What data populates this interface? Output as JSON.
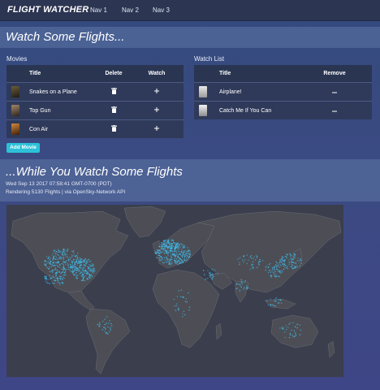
{
  "nav": {
    "brand": "FLIGHT WATCHER",
    "links": [
      "Nav 1",
      "Nav 2",
      "Nav 3"
    ]
  },
  "section1": {
    "title": "Watch Some Flights..."
  },
  "movies": {
    "label": "Movies",
    "columns": {
      "title": "Title",
      "delete": "Delete",
      "watch": "Watch"
    },
    "rows": [
      {
        "title": "Snakes on a Plane",
        "poster_color": "#3b3522"
      },
      {
        "title": "Top Gun",
        "poster_color": "#5a4c3e"
      },
      {
        "title": "Con Air",
        "poster_color": "#8a5a2a"
      }
    ],
    "delete_icon": "trash-icon",
    "watch_icon": "plus-icon",
    "add_button": "Add Movie"
  },
  "watchlist": {
    "label": "Watch List",
    "columns": {
      "title": "Title",
      "remove": "Remove"
    },
    "rows": [
      {
        "title": "Airplane!",
        "poster_color": "#c9c9c9"
      },
      {
        "title": "Catch Me If You Can",
        "poster_color": "#e4e4e4"
      }
    ],
    "remove_icon": "minus-icon"
  },
  "section2": {
    "title": "...While You Watch Some Flights",
    "timestamp": "Wed Sep 13 2017 07:58:41 GMT-0700 (PDT)",
    "status": "Rendering 5130 Flights | via OpenSky-Network API"
  },
  "colors": {
    "background": "#3b4a82",
    "navbar": "#2c3551",
    "table_row": "#2f3a5a",
    "map_ocean": "#3a3e4d",
    "map_land": "#4d4e55",
    "flight_dot": "#3fb8e8",
    "accent": "#2cc1d8"
  }
}
